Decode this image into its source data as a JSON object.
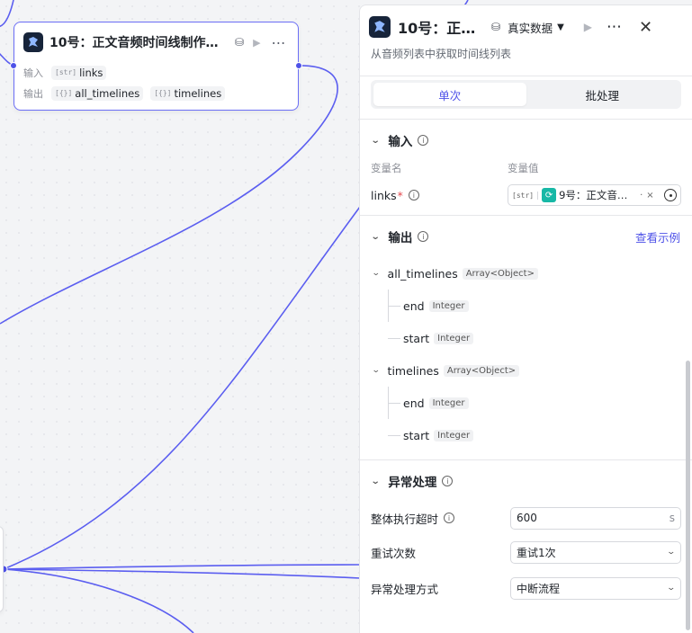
{
  "canvas_node": {
    "title": "10号：正文音频时间线制作a…",
    "input_label": "输入",
    "output_label": "输出",
    "inputs": [
      {
        "type": "[str]",
        "name": "links"
      }
    ],
    "outputs": [
      {
        "type": "[{}]",
        "name": "all_timelines"
      },
      {
        "type": "[{}]",
        "name": "timelines"
      }
    ]
  },
  "panel": {
    "title": "10号：正…",
    "data_mode": "真实数据",
    "description": "从音频列表中获取时间线列表",
    "tabs": [
      {
        "label": "单次",
        "active": true
      },
      {
        "label": "批处理",
        "active": false
      }
    ],
    "input_section": {
      "title": "输入",
      "col_name": "变量名",
      "col_value": "变量值",
      "var_name": "links",
      "ref_type": "[str]",
      "ref_value": "9号：正文音频…",
      "ref_dot": "·",
      "ref_remove": "×"
    },
    "output_section": {
      "title": "输出",
      "see_example": "查看示例",
      "fields": [
        {
          "name": "all_timelines",
          "type": "Array<Object>",
          "children": [
            {
              "name": "end",
              "type": "Integer"
            },
            {
              "name": "start",
              "type": "Integer"
            }
          ]
        },
        {
          "name": "timelines",
          "type": "Array<Object>",
          "children": [
            {
              "name": "end",
              "type": "Integer"
            },
            {
              "name": "start",
              "type": "Integer"
            }
          ]
        }
      ]
    },
    "exception_section": {
      "title": "异常处理",
      "timeout_label": "整体执行超时",
      "timeout_value": "600",
      "timeout_unit": "s",
      "retry_label": "重试次数",
      "retry_value": "重试1次",
      "handling_label": "异常处理方式",
      "handling_value": "中断流程"
    }
  },
  "colors": {
    "accent": "#4e52e8",
    "edge": "#5b5ef0",
    "teal": "#17b8a6"
  }
}
